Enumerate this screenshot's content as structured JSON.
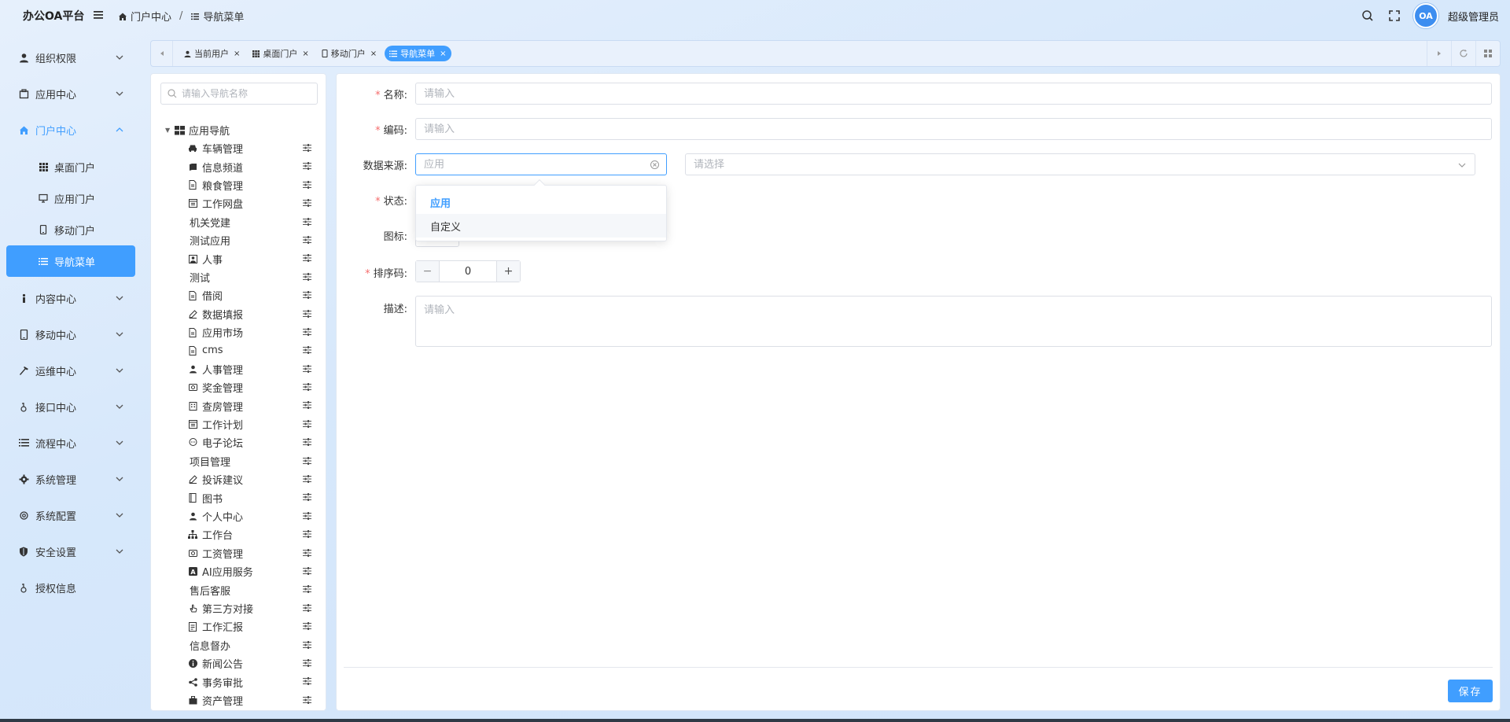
{
  "app": {
    "title": "办公OA平台"
  },
  "breadcrumb": [
    "门户中心",
    "导航菜单"
  ],
  "header": {
    "username": "超级管理员",
    "avatar_text": "OA"
  },
  "sidebar": {
    "items": [
      {
        "label": "组织权限",
        "icon": "user-icon"
      },
      {
        "label": "应用中心",
        "icon": "app-icon"
      },
      {
        "label": "门户中心",
        "icon": "home-icon",
        "children": [
          {
            "label": "桌面门户",
            "icon": "grid-icon"
          },
          {
            "label": "应用门户",
            "icon": "screen-icon"
          },
          {
            "label": "移动门户",
            "icon": "mobile-icon"
          },
          {
            "label": "导航菜单",
            "icon": "list-icon"
          }
        ]
      },
      {
        "label": "内容中心",
        "icon": "info-icon"
      },
      {
        "label": "移动中心",
        "icon": "mobile-icon"
      },
      {
        "label": "运维中心",
        "icon": "hammer-icon"
      },
      {
        "label": "接口中心",
        "icon": "plug-icon"
      },
      {
        "label": "流程中心",
        "icon": "flow-icon"
      },
      {
        "label": "系统管理",
        "icon": "gear-icon"
      },
      {
        "label": "系统配置",
        "icon": "settings-icon"
      },
      {
        "label": "安全设置",
        "icon": "shield-icon"
      },
      {
        "label": "授权信息",
        "icon": "key-icon"
      }
    ]
  },
  "tabs": [
    {
      "label": "当前用户"
    },
    {
      "label": "桌面门户"
    },
    {
      "label": "移动门户"
    },
    {
      "label": "导航菜单"
    }
  ],
  "tree": {
    "search_placeholder": "请输入导航名称",
    "root": "应用导航",
    "nodes": [
      "车辆管理",
      "信息频道",
      "粮食管理",
      "工作网盘",
      "机关党建",
      "测试应用",
      "人事",
      "测试",
      "借阅",
      "数据填报",
      "应用市场",
      "cms",
      "人事管理",
      "奖金管理",
      "查房管理",
      "工作计划",
      "电子论坛",
      "项目管理",
      "投诉建议",
      "图书",
      "个人中心",
      "工作台",
      "工资管理",
      "AI应用服务",
      "售后客服",
      "第三方对接",
      "工作汇报",
      "信息督办",
      "新闻公告",
      "事务审批",
      "资产管理"
    ]
  },
  "form": {
    "name_label": "名称:",
    "code_label": "编码:",
    "source_label": "数据来源:",
    "status_label": "状态:",
    "icon_label": "图标:",
    "sort_label": "排序码:",
    "desc_label": "描述:",
    "placeholder": "请输入",
    "source_value": "应用",
    "select_placeholder": "请选择",
    "sort_value": "0",
    "options": [
      "应用",
      "自定义"
    ],
    "save_label": "保存"
  },
  "colors": {
    "accent": "#409eff",
    "required": "#f56c6c"
  }
}
